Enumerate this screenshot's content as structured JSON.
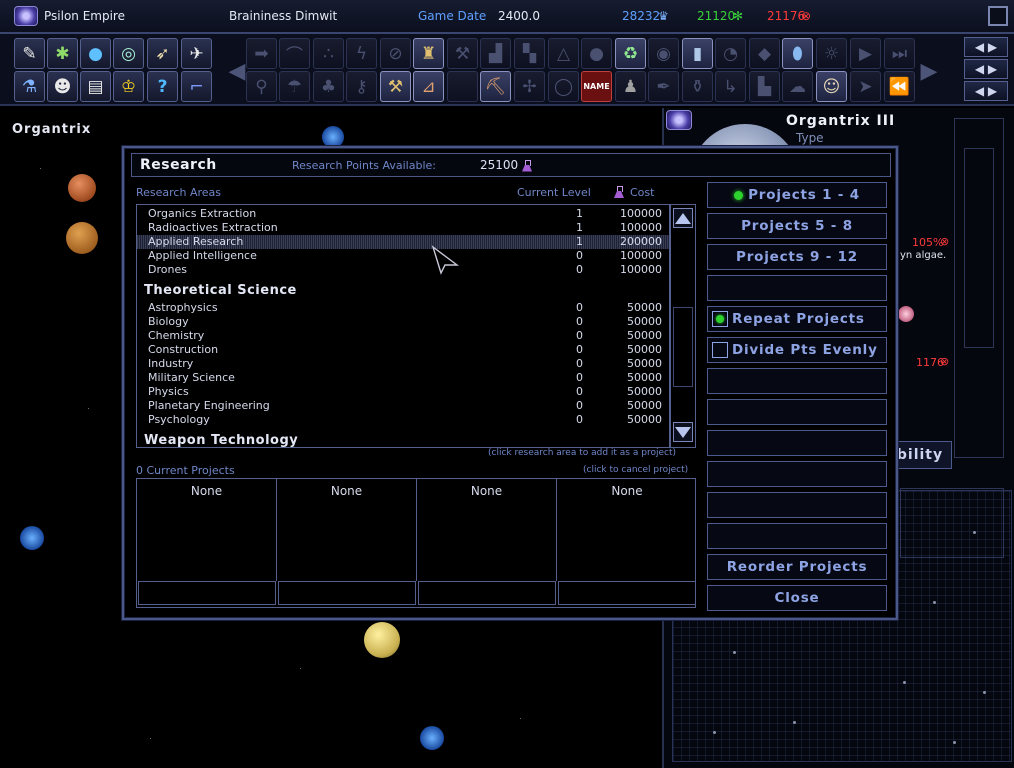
{
  "topbar": {
    "empire_name": "Psilon Empire",
    "leader_name": "Braininess Dimwit",
    "game_date_label": "Game Date",
    "game_date_value": "2400.0",
    "credits": "28232",
    "food": "21120",
    "command": "21176"
  },
  "system_name": "Organtrix",
  "planet_panel": {
    "title": "Organtrix III",
    "type_label": "Type",
    "percent": "105%",
    "note": "yn algae.",
    "value": "1176",
    "bility_label": "bility"
  },
  "research": {
    "title": "Research",
    "points_label": "Research Points Available:",
    "points_value": "25100",
    "columns": {
      "areas": "Research Areas",
      "level": "Current Level",
      "cost": "Cost"
    },
    "rows_top": [
      {
        "name": "Organics Extraction",
        "level": "1",
        "cost": "100000"
      },
      {
        "name": "Radioactives Extraction",
        "level": "1",
        "cost": "100000"
      },
      {
        "name": "Applied Research",
        "level": "1",
        "cost": "200000"
      },
      {
        "name": "Applied Intelligence",
        "level": "0",
        "cost": "100000"
      },
      {
        "name": "Drones",
        "level": "0",
        "cost": "100000"
      }
    ],
    "category_1": "Theoretical Science",
    "rows_theory": [
      {
        "name": "Astrophysics",
        "level": "0",
        "cost": "50000"
      },
      {
        "name": "Biology",
        "level": "0",
        "cost": "50000"
      },
      {
        "name": "Chemistry",
        "level": "0",
        "cost": "50000"
      },
      {
        "name": "Construction",
        "level": "0",
        "cost": "50000"
      },
      {
        "name": "Industry",
        "level": "0",
        "cost": "50000"
      },
      {
        "name": "Military Science",
        "level": "0",
        "cost": "50000"
      },
      {
        "name": "Physics",
        "level": "0",
        "cost": "50000"
      },
      {
        "name": "Planetary Engineering",
        "level": "0",
        "cost": "50000"
      },
      {
        "name": "Psychology",
        "level": "0",
        "cost": "50000"
      }
    ],
    "category_2": "Weapon Technology",
    "hint_add": "(click research area to add it as a project)",
    "current_projects_label": "0 Current Projects",
    "hint_cancel": "(click to cancel project)",
    "projects": [
      "None",
      "None",
      "None",
      "None"
    ],
    "buttons": {
      "tab1": "Projects 1 - 4",
      "tab2": "Projects 5 - 8",
      "tab3": "Projects 9 - 12",
      "repeat": "Repeat Projects",
      "divide": "Divide Pts Evenly",
      "reorder": "Reorder Projects",
      "close": "Close"
    },
    "repeat_checked": true,
    "divide_checked": false
  },
  "toolbar_icons": {
    "row1_left": [
      "scroll-icon",
      "spider-icon",
      "globe-icon",
      "ring-icon",
      "ships-icon",
      "satellite-icon"
    ],
    "row2_left": [
      "flask-icon",
      "alien-icon",
      "notes-icon",
      "crown-icon",
      "help-icon",
      "pipe-icon"
    ],
    "name_button": "NAME"
  },
  "colors": {
    "accent_blue": "#8ea3e4",
    "label_blue": "#6f86c8",
    "green": "#2ed22e",
    "red": "#ff3a3a"
  }
}
